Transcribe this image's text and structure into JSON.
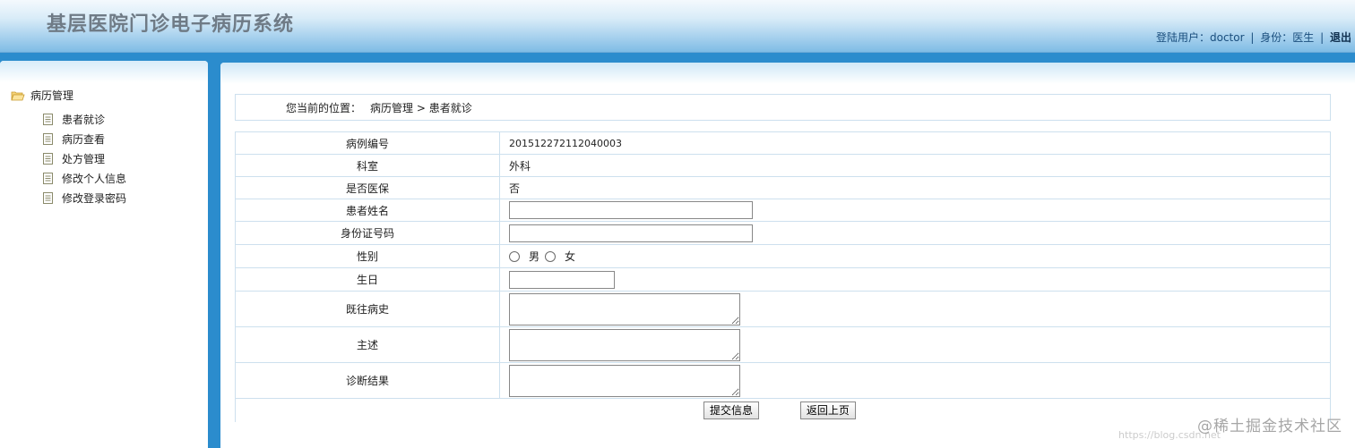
{
  "header": {
    "title": "基层医院门诊电子病历系统",
    "user_label": "登陆用户：",
    "username": "doctor",
    "role_label": "身份：",
    "role": "医生",
    "logout": "退出"
  },
  "sidebar": {
    "root_label": "病历管理",
    "items": [
      {
        "label": "患者就诊"
      },
      {
        "label": "病历查看"
      },
      {
        "label": "处方管理"
      },
      {
        "label": "修改个人信息"
      },
      {
        "label": "修改登录密码"
      }
    ]
  },
  "breadcrumb": {
    "lead": "您当前的位置：",
    "path": "病历管理 > 患者就诊"
  },
  "form": {
    "record_no_label": "病例编号",
    "record_no": "201512272112040003",
    "dept_label": "科室",
    "dept": "外科",
    "insurance_label": "是否医保",
    "insurance": "否",
    "name_label": "患者姓名",
    "name_value": "",
    "idcard_label": "身份证号码",
    "idcard_value": "",
    "gender_label": "性别",
    "gender_options": [
      "男",
      "女"
    ],
    "birthday_label": "生日",
    "birthday_value": "",
    "history_label": "既往病史",
    "complaint_label": "主述",
    "diagnosis_label": "诊断结果",
    "submit": "提交信息",
    "back": "返回上页"
  },
  "watermark": {
    "text": "@稀土掘金技术社区",
    "url": "https://blog.csdn.net"
  }
}
